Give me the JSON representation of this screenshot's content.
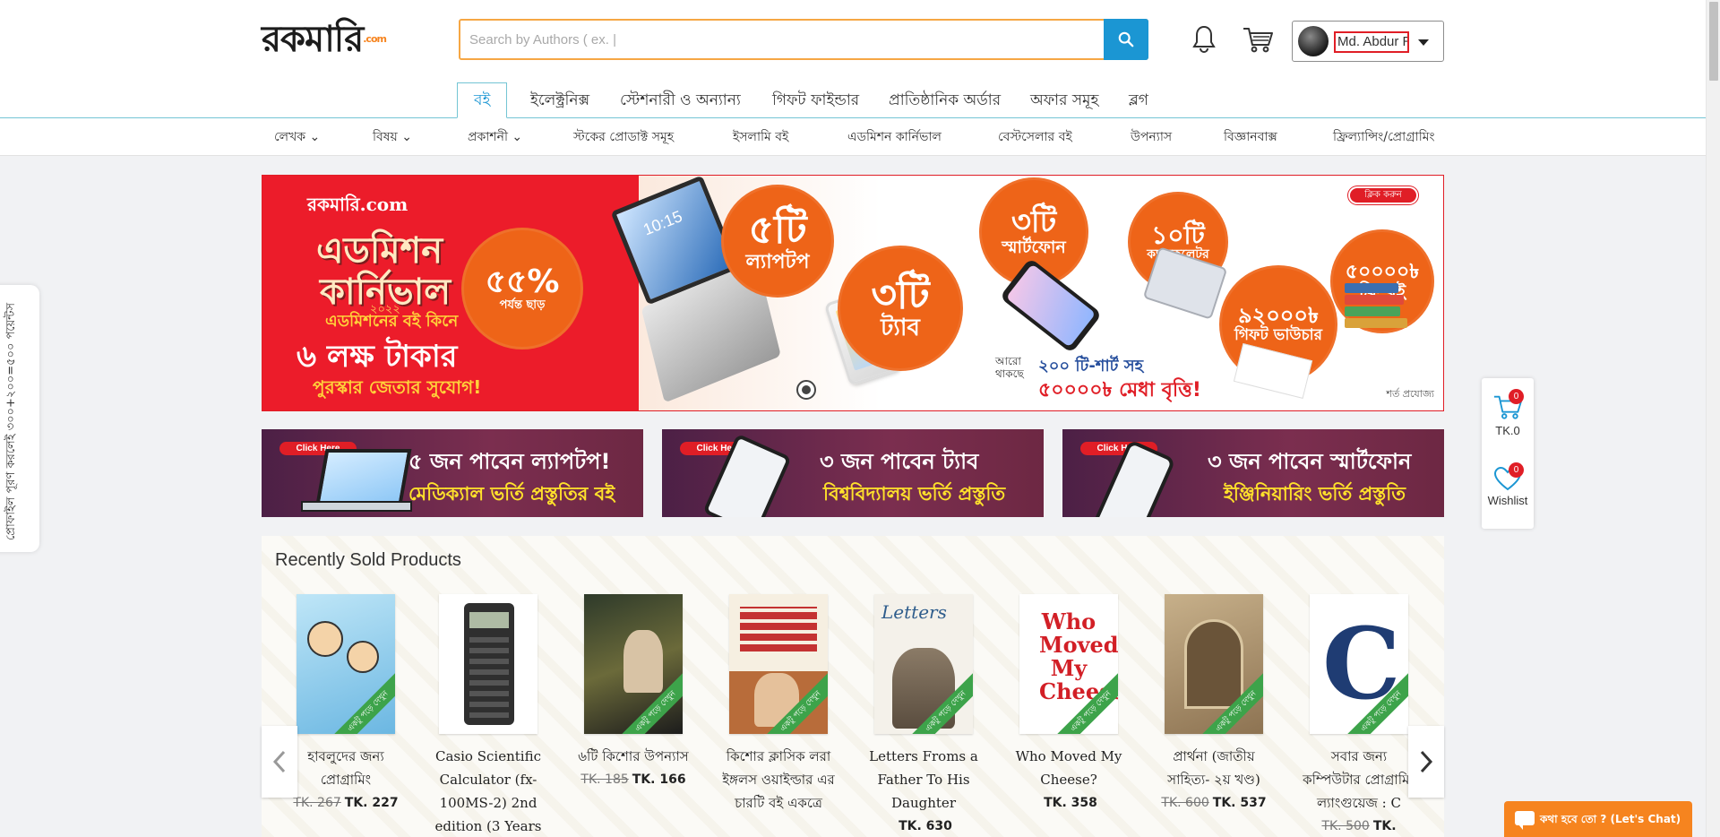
{
  "header": {
    "logo_text": "রকমারি",
    "logo_suffix": ".com",
    "search_placeholder": "Search by Authors ( ex. |",
    "account_name": "Md. Abdur R"
  },
  "tabs": [
    {
      "label": "বই",
      "active": true
    },
    {
      "label": "ইলেক্ট্রনিক্স"
    },
    {
      "label": "স্টেশনারী ও অন্যান্য"
    },
    {
      "label": "গিফট ফাইন্ডার"
    },
    {
      "label": "প্রাতিষ্ঠানিক অর্ডার"
    },
    {
      "label": "অফার সমূহ"
    },
    {
      "label": "ব্লগ"
    }
  ],
  "subnav": [
    {
      "label": "লেখক ⌄"
    },
    {
      "label": "বিষয় ⌄"
    },
    {
      "label": "প্রকাশনী ⌄"
    },
    {
      "label": "স্টকের প্রোডাক্ট সমূহ"
    },
    {
      "label": "ইসলামি বই"
    },
    {
      "label": "এডমিশন কার্নিভাল"
    },
    {
      "label": "বেস্টসেলার বই"
    },
    {
      "label": "উপন্যাস"
    },
    {
      "label": "বিজ্ঞানবাক্স"
    },
    {
      "label": "ফ্রিল্যান্সিং/প্রোগ্রামিং"
    }
  ],
  "banner": {
    "logo": "রকমারি.com",
    "title_1": "এডমিশন",
    "title_2": "কার্নিভাল",
    "year": "২০২২",
    "line_1": "এডমিশনের বই কিনে",
    "line_2": "৬ লক্ষ টাকার",
    "line_3": "পুরস্কার জেতার সুযোগ!",
    "discount_pct": "৫৫%",
    "discount_text": "পর্যন্ত ছাড়",
    "laptop_time": "10:15",
    "laptop_big": "৫টি",
    "laptop_label": "ল্যাপটপ",
    "tab_big": "৩টি",
    "tab_label": "ট্যাব",
    "phone_big": "৩টি",
    "phone_label": "স্মার্টফোন",
    "calc_big": "১০টি",
    "calc_label": "ক্যালকুলেটর",
    "voucher_big": "৯২০০০৳",
    "voucher_label": "গিফট ভাউচার",
    "free_big": "৫০০০০৳",
    "free_label": "ফ্রি বই",
    "more_label": "আরো থাকছে",
    "tshirt_text": "২০০ টি-শার্ট সহ",
    "scholarship_text": "৫০০০০৳ মেধা বৃত্তি!",
    "click_pill": "ক্লিক করুন",
    "terms": "শর্ত প্রযোজ্য"
  },
  "promos": [
    {
      "click": "Click Here",
      "line_1": "৫ জন পাবেন ল্যাপটপ!",
      "line_2": "মেডিক্যাল ভর্তি প্রস্তুতির বই"
    },
    {
      "click": "Click Here",
      "line_1": "৩ জন পাবেন ট্যাব",
      "line_2": "বিশ্ববিদ্যালয় ভর্তি প্রস্তুতি"
    },
    {
      "click": "Click Here",
      "line_1": "৩ জন পাবেন স্মার্টফোন",
      "line_2": "ইঞ্জিনিয়ারিং ভর্তি প্রস্তুতি"
    }
  ],
  "recently_sold": {
    "title": "Recently Sold Products",
    "ribbon": "একটু পড়ে দেখুন",
    "products": [
      {
        "name": "হাবলুদের জন্য প্রোগ্রামিং",
        "old_price": "TK. 267",
        "price": "TK. 227"
      },
      {
        "name": "Casio Scientific Calculator (fx-100MS-2) 2nd edition (3 Years",
        "old_price": "",
        "price": ""
      },
      {
        "name": "৬টি কিশোর উপন্যাস",
        "old_price": "TK. 185",
        "price": "TK. 166"
      },
      {
        "name": "কিশোর ক্লাসিক লরা ইঙ্গলস ওয়াইল্ডার এর চারটি বই একত্রে",
        "old_price": "",
        "price": ""
      },
      {
        "name": "Letters Froms a Father To His Daughter",
        "old_price": "",
        "price": "TK. 630"
      },
      {
        "name": "Who Moved My Cheese?",
        "old_price": "",
        "price": "TK. 358"
      },
      {
        "name": "প্রার্থনা (জাতীয় সাহিত্য- ২য় খণ্ড)",
        "old_price": "TK. 600",
        "price": "TK. 537"
      },
      {
        "name": "সবার জন্য কম্পিউটার প্রোগ্রামিং ল্যাংগুয়েজ : C",
        "old_price": "TK. 500",
        "price": "TK."
      }
    ]
  },
  "side": {
    "left_tab": "প্রোফাইল পূরণ করলেই ৩০০+২০০=৫০০ পয়েন্টস",
    "cart_count": "0",
    "cart_total": "TK.0",
    "wishlist_count": "0",
    "wishlist_label": "Wishlist"
  },
  "chat": {
    "label": "কথা হবে তো ? (Let's Chat)"
  },
  "colors": {
    "brand_orange": "#f6841f",
    "search_blue": "#1b96d3",
    "red": "#e01e26"
  }
}
